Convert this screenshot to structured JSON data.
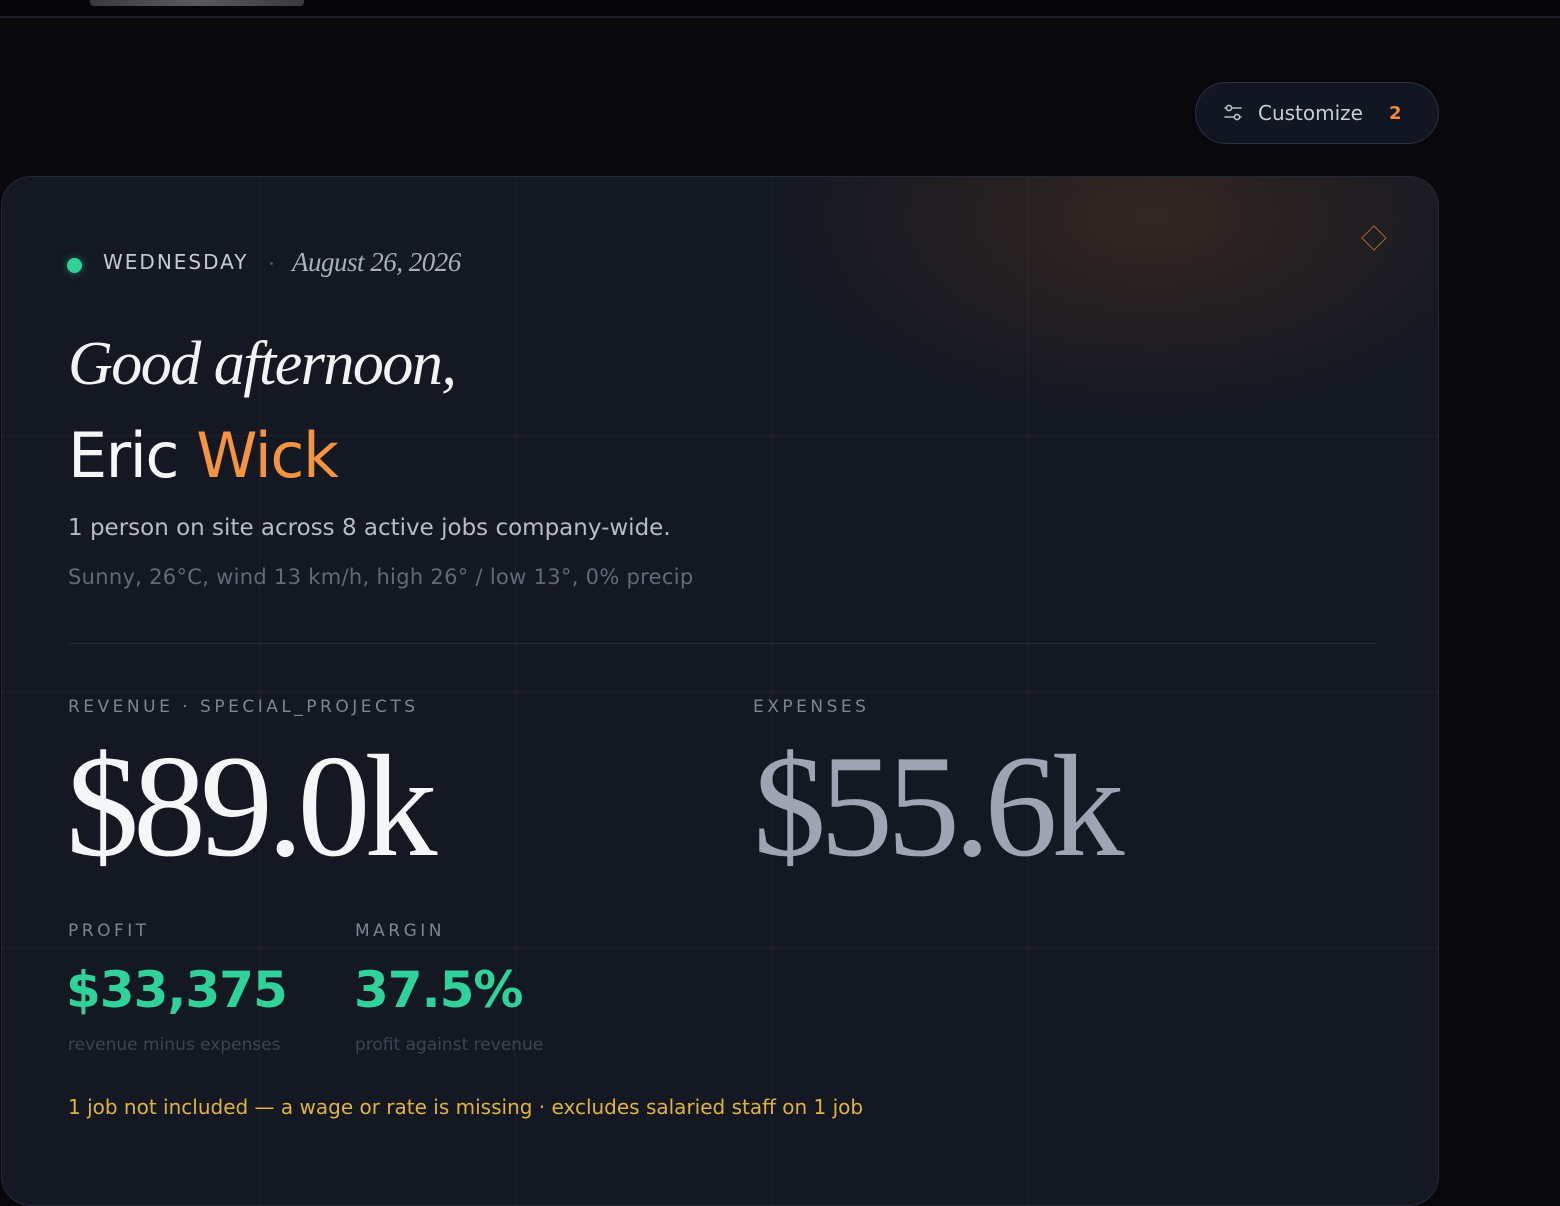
{
  "header": {
    "customize_label": "Customize",
    "customize_count": "2"
  },
  "card": {
    "weekday": "WEDNESDAY",
    "date": "August 26, 2026",
    "greeting": "Good afternoon,",
    "first_name": "Eric",
    "last_name": "Wick",
    "summary": "1 person on site across 8 active jobs company-wide.",
    "weather": "Sunny, 26°C, wind 13 km/h, high 26° / low 13°, 0% precip"
  },
  "metrics": {
    "revenue_label": "REVENUE · SPECIAL_PROJECTS",
    "revenue_value": "$89.0k",
    "expenses_label": "EXPENSES",
    "expenses_value": "$55.6k",
    "profit_label": "PROFIT",
    "profit_value": "$33,375",
    "profit_sub": "revenue minus expenses",
    "margin_label": "MARGIN",
    "margin_value": "37.5%",
    "margin_sub": "profit against revenue"
  },
  "warning": "1 job not included — a wage or rate is missing · excludes salaried staff on 1 job",
  "colors": {
    "accent_orange": "#f49342",
    "positive_green": "#2fd39a",
    "warning_yellow": "#e0b43b",
    "background": "#09090b",
    "card": "#141822"
  },
  "icons": {
    "customize": "sliders-icon",
    "corner": "diamond-icon"
  }
}
